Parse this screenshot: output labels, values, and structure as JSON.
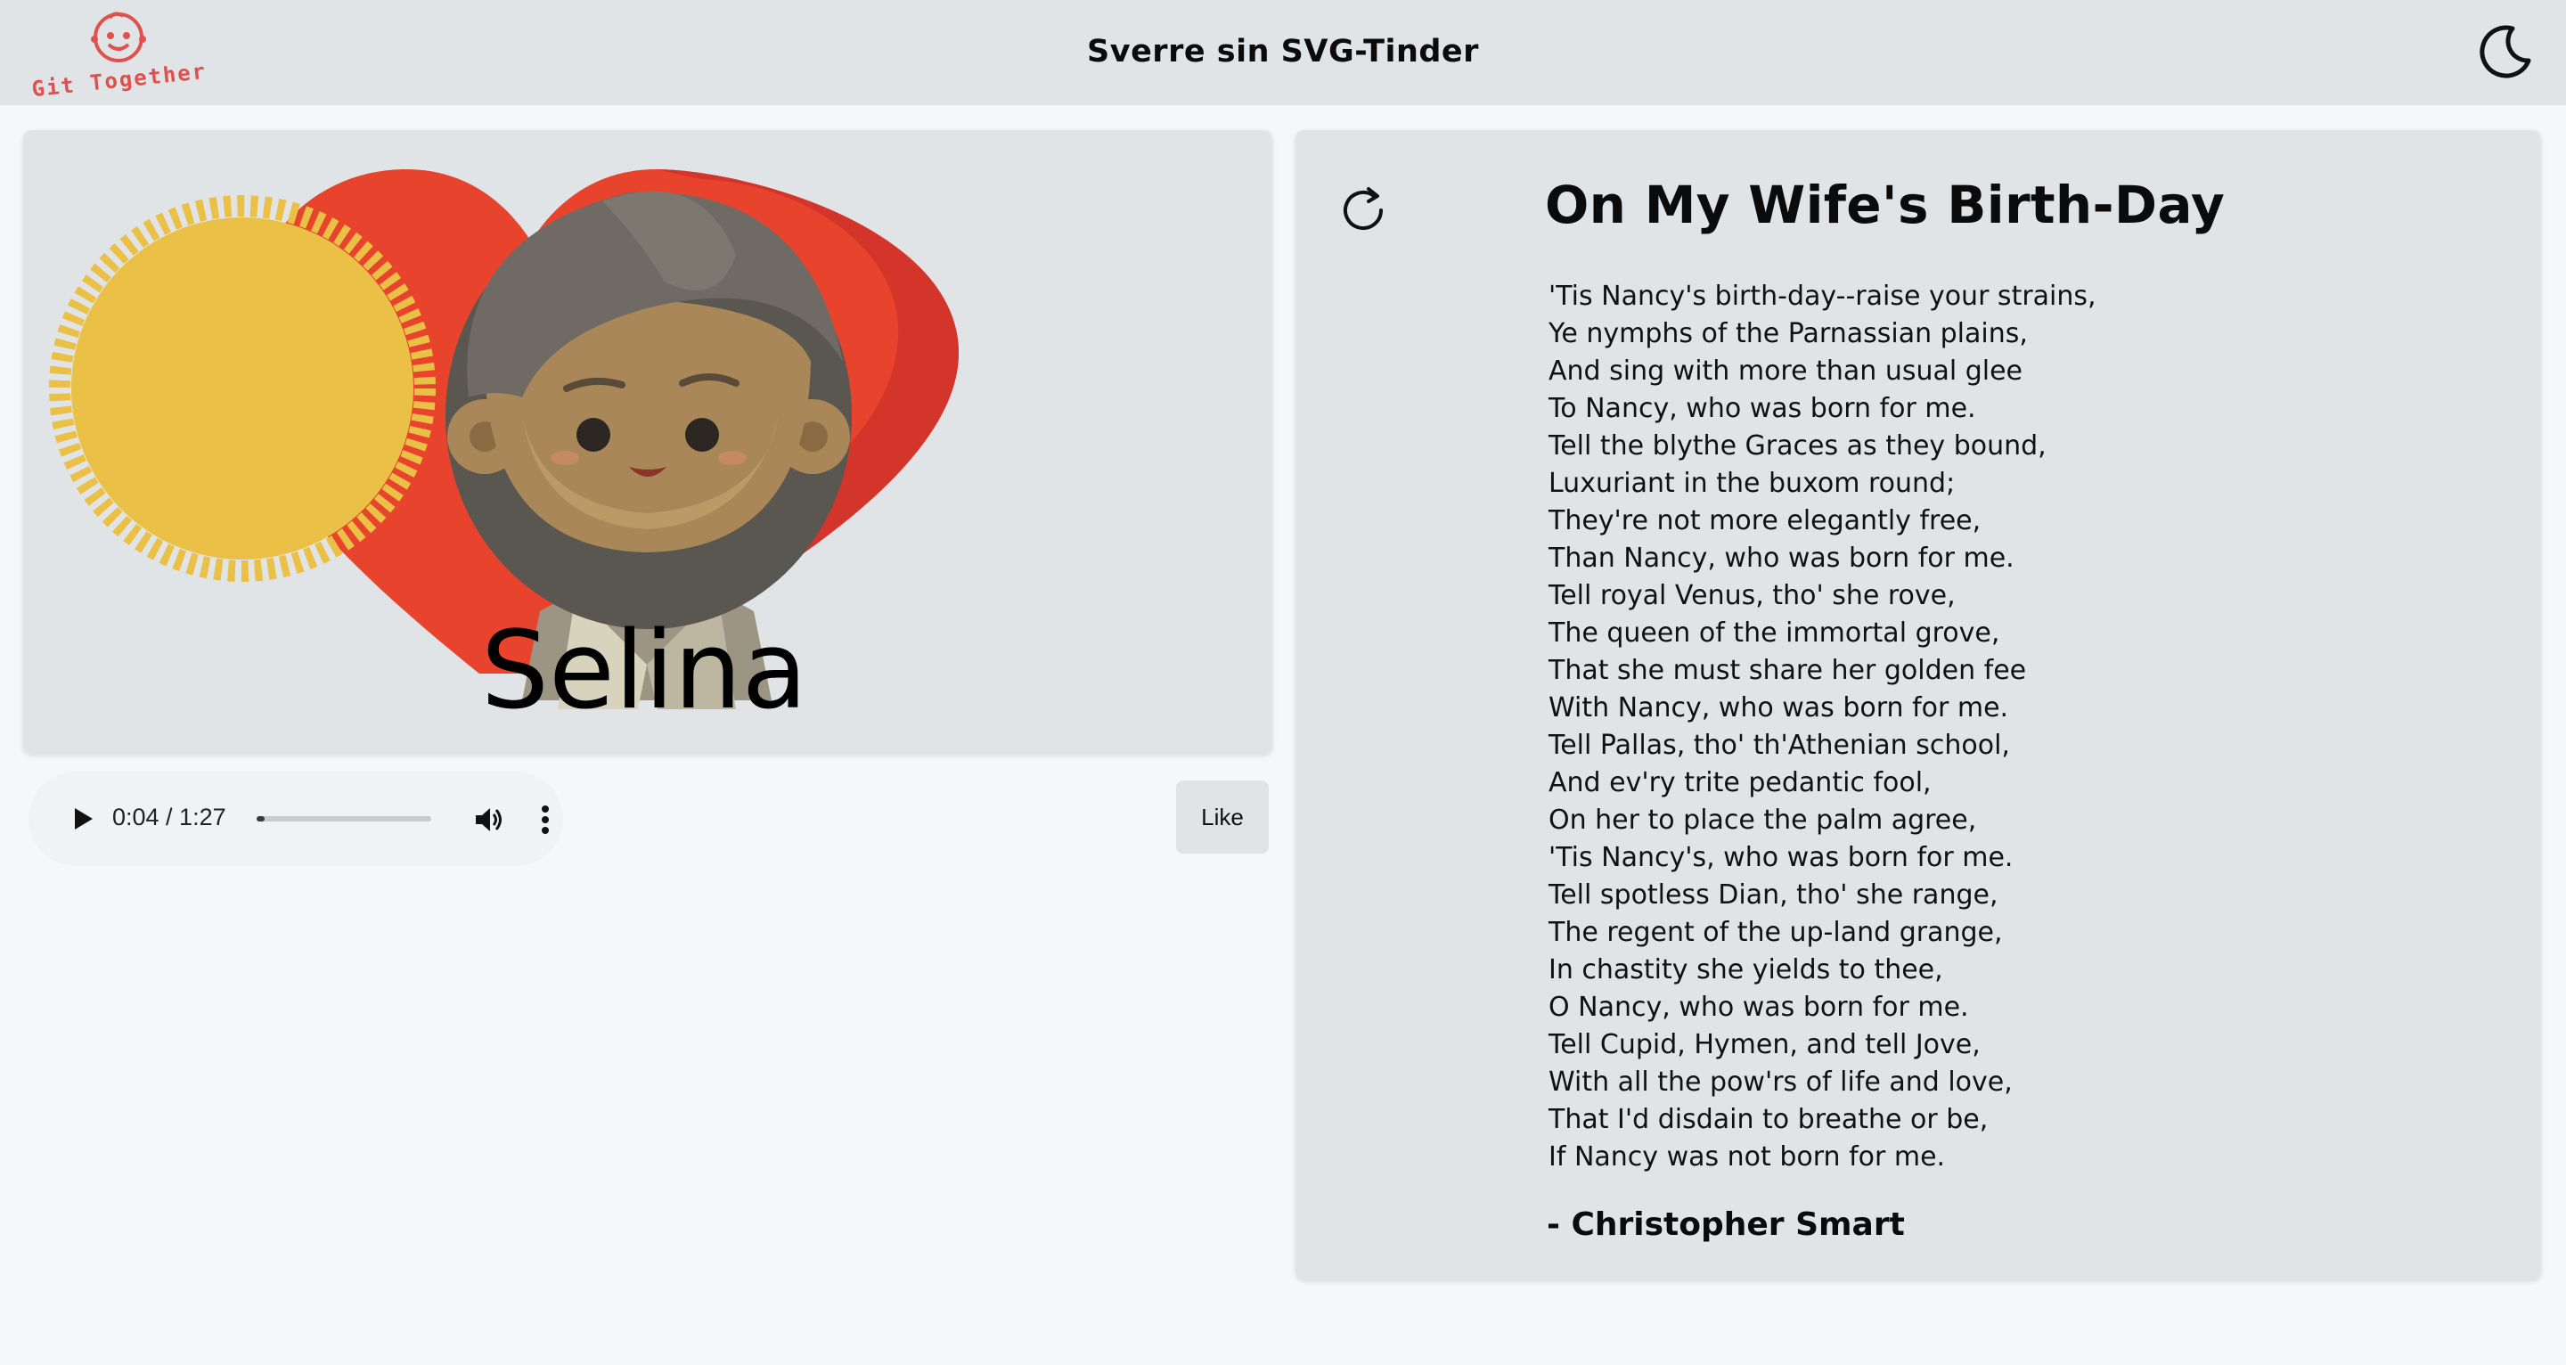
{
  "header": {
    "logo_text": "Git Together",
    "title": "Sverre sin SVG-Tinder",
    "theme_toggle_icon": "moon-icon"
  },
  "art": {
    "name": "Selina",
    "icons": [
      "sun-icon",
      "heart-icon",
      "person-avatar"
    ]
  },
  "audio": {
    "time": "0:04 / 1:27",
    "progress_fraction": 0.046,
    "play_icon": "play-icon",
    "volume_icon": "volume-icon",
    "more_icon": "more-options-icon"
  },
  "actions": {
    "like_label": "Like"
  },
  "poem": {
    "refresh_icon": "refresh-icon",
    "title": "On My Wife's Birth-Day",
    "lines": [
      "'Tis Nancy's birth-day--raise your strains,",
      "Ye nymphs of the Parnassian plains,",
      "And sing with more than usual glee",
      "To Nancy, who was born for me.",
      "Tell the blythe Graces as they bound,",
      "Luxuriant in the buxom round;",
      "They're not more elegantly free,",
      "Than Nancy, who was born for me.",
      "Tell royal Venus, tho' she rove,",
      "The queen of the immortal grove,",
      "That she must share her golden fee",
      "With Nancy, who was born for me.",
      "Tell Pallas, tho' th'Athenian school,",
      "And ev'ry trite pedantic fool,",
      "On her to place the palm agree,",
      "'Tis Nancy's, who was born for me.",
      "Tell spotless Dian, tho' she range,",
      "The regent of the up-land grange,",
      "In chastity she yields to thee,",
      "O Nancy, who was born for me.",
      "Tell Cupid, Hymen, and tell Jove,",
      "With all the pow'rs of life and love,",
      "That I'd disdain to breathe or be,",
      "If Nancy was not born for me."
    ],
    "author": "- Christopher Smart"
  },
  "colors": {
    "header_bg": "#e0e4e7",
    "card_bg": "#e0e4e7",
    "page_bg": "#f6f7f8",
    "logo_red": "#e0504c",
    "sun_yellow": "#ebc046",
    "heart_red": "#e8432d"
  }
}
